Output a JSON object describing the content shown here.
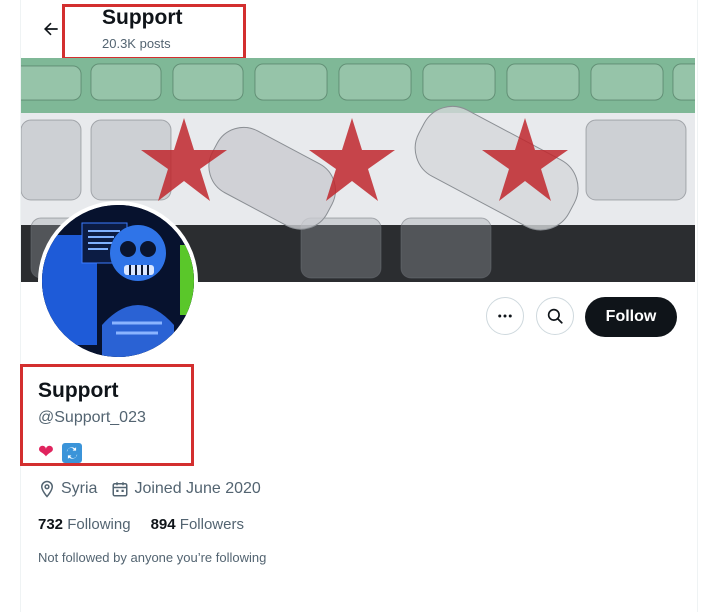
{
  "header": {
    "title": "Support",
    "posts": "20.3K posts"
  },
  "profile": {
    "name": "Support",
    "handle": "@Support_023",
    "location": "Syria",
    "joined": "Joined June 2020",
    "following_count": "732",
    "following_label": "Following",
    "followers_count": "894",
    "followers_label": "Followers",
    "note": "Not followed by anyone you’re following"
  },
  "actions": {
    "follow_label": "Follow"
  },
  "icons": {
    "back": "arrow-left-icon",
    "more": "more-dots-icon",
    "search": "search-icon",
    "location": "location-pin-icon",
    "calendar": "calendar-icon",
    "heart": "heart-icon",
    "retweet": "retweet-icon"
  },
  "colors": {
    "highlight_box": "#d32f2f",
    "follow_bg": "#0f1419",
    "flag_green": "#5a9e74",
    "flag_star": "#c0272d"
  }
}
